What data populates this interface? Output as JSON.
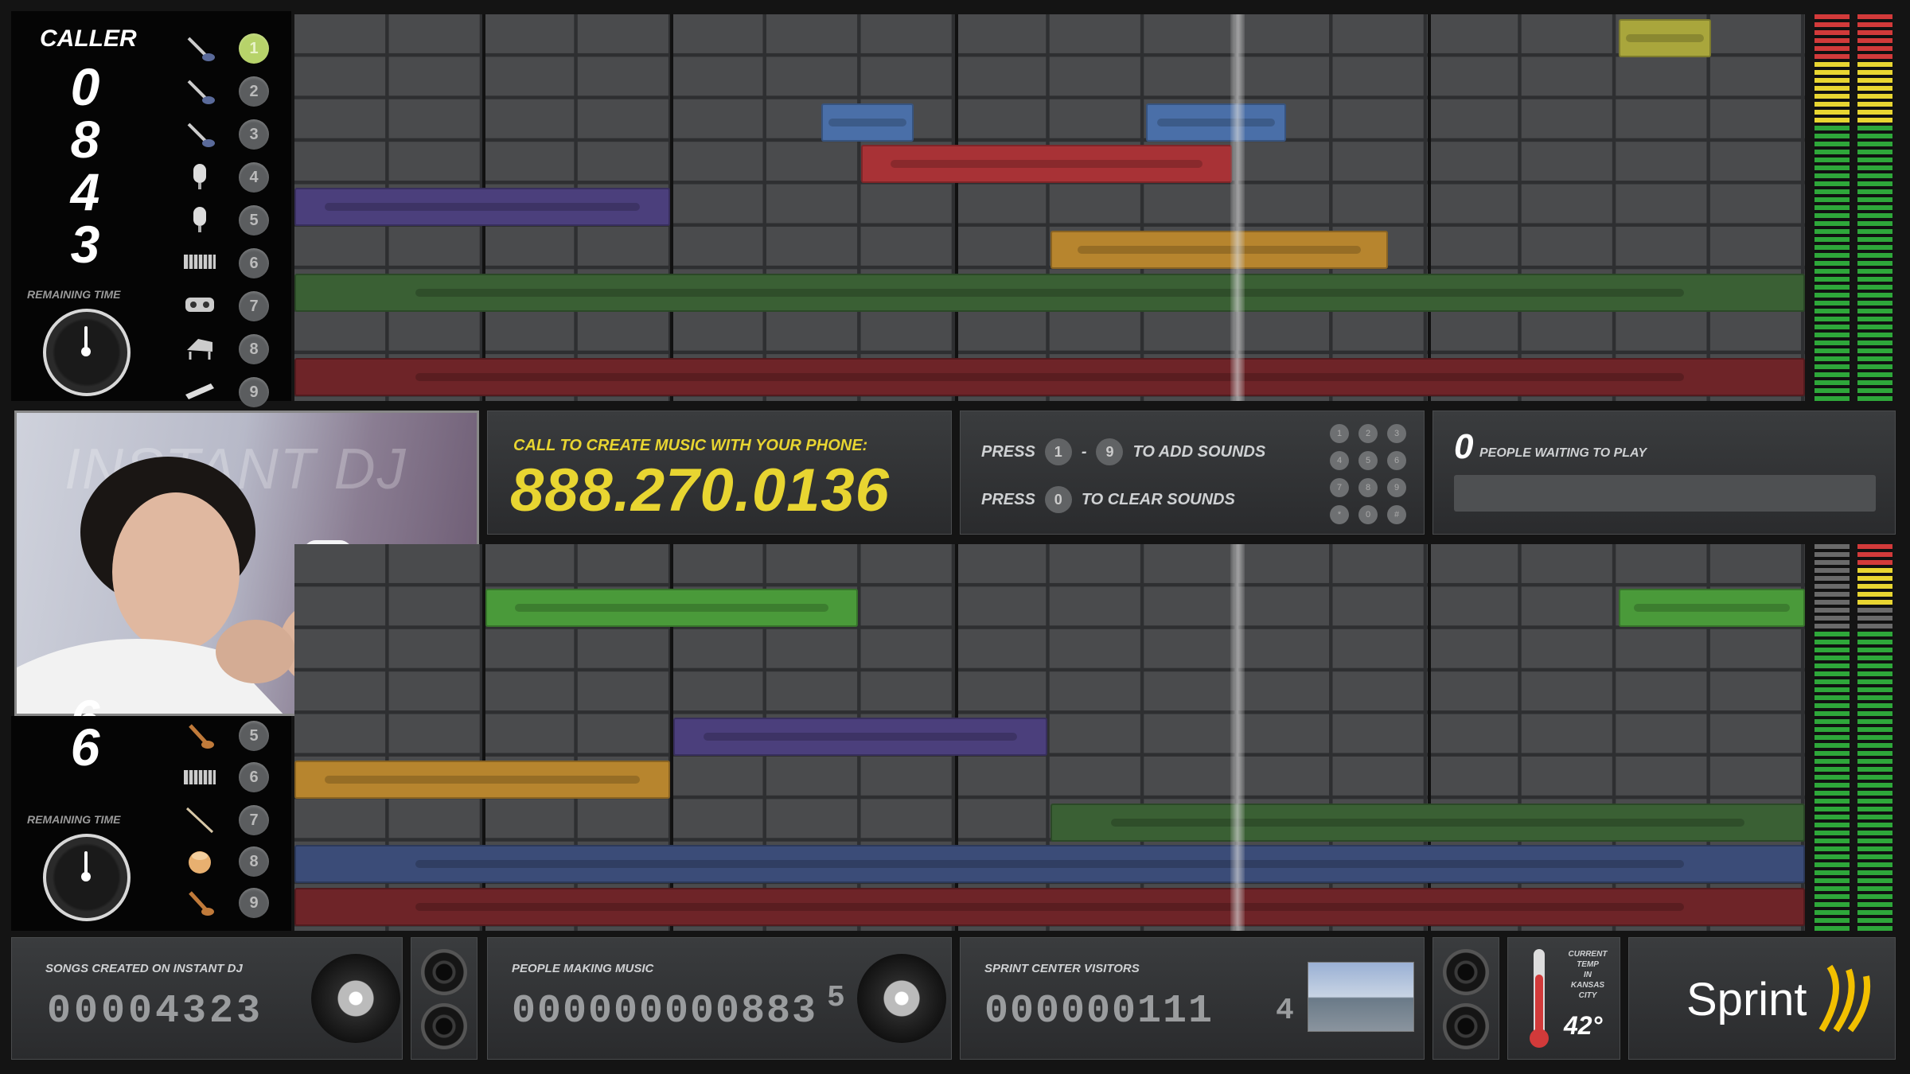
{
  "top_caller": {
    "label": "CALLER",
    "digits": [
      "0",
      "8",
      "4",
      "3"
    ],
    "remaining_label": "REMAINING TIME",
    "slots": [
      "1",
      "2",
      "3",
      "4",
      "5",
      "6",
      "7",
      "8",
      "9"
    ]
  },
  "bottom_caller": {
    "digits": [
      "6",
      "6"
    ],
    "remaining_label": "REMAINING TIME",
    "slots": [
      "5",
      "6",
      "7",
      "8",
      "9"
    ]
  },
  "video": {
    "watermark": "INSTANT DJ"
  },
  "call": {
    "title": "CALL TO CREATE MUSIC WITH YOUR PHONE:",
    "number": "888.270.0136"
  },
  "instructions": {
    "press1": "PRESS",
    "key_from": "1",
    "dash": "-",
    "key_to": "9",
    "add_text": "TO ADD SOUNDS",
    "press2": "PRESS",
    "key_clear": "0",
    "clear_text": "TO CLEAR SOUNDS",
    "keypad": [
      "1",
      "2",
      "3",
      "4",
      "5",
      "6",
      "7",
      "8",
      "9",
      "*",
      "0",
      "#"
    ]
  },
  "queue": {
    "count": "0",
    "label": "PEOPLE WAITING TO PLAY"
  },
  "stats": {
    "songs_label": "SONGS CREATED ON INSTANT DJ",
    "songs_value": "00004323",
    "people_label": "PEOPLE MAKING MUSIC",
    "people_value": "000000000883",
    "people_roll": "5",
    "visitors_label": "SPRINT CENTER VISITORS",
    "visitors_value": "000000111",
    "visitors_roll": "4"
  },
  "weather": {
    "line1": "CURRENT",
    "line2": "TEMP",
    "line3": "IN",
    "line4": "KANSAS",
    "line5": "CITY",
    "temp": "42°"
  },
  "brand": {
    "name": "Sprint"
  },
  "colors": {
    "yellow": "#e8d531",
    "clip_blue": "#4a6fa8",
    "clip_red": "#a83236",
    "clip_purple": "#4b3f7c",
    "clip_orange": "#b7852e",
    "clip_green": "#3a6034",
    "clip_bright_green": "#4a9a3a",
    "clip_darkred": "#6e2428",
    "clip_lime": "#a9a63c"
  }
}
